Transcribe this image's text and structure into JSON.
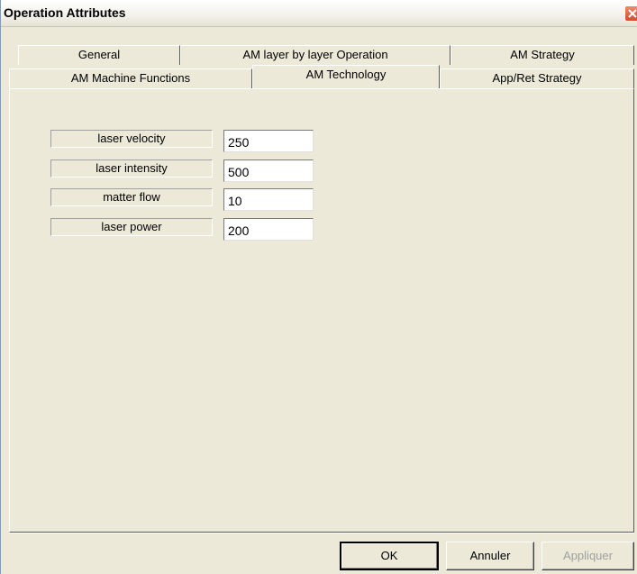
{
  "window": {
    "title": "Operation Attributes"
  },
  "tabs": {
    "row_back": [
      "General",
      "AM layer by layer Operation",
      "AM Strategy"
    ],
    "row_front": [
      "AM Machine Functions",
      "AM Technology",
      "App/Ret Strategy"
    ],
    "active": "AM Technology"
  },
  "fields": [
    {
      "label": "laser velocity",
      "value": "250"
    },
    {
      "label": "laser intensity",
      "value": "500"
    },
    {
      "label": "matter flow",
      "value": "10"
    },
    {
      "label": "laser power",
      "value": "200"
    }
  ],
  "buttons": {
    "ok": "OK",
    "cancel": "Annuler",
    "apply": "Appliquer"
  },
  "icons": {
    "close": "close-icon"
  },
  "colors": {
    "dialog_bg": "#ece9d8",
    "close_button": "#d44a2a"
  }
}
